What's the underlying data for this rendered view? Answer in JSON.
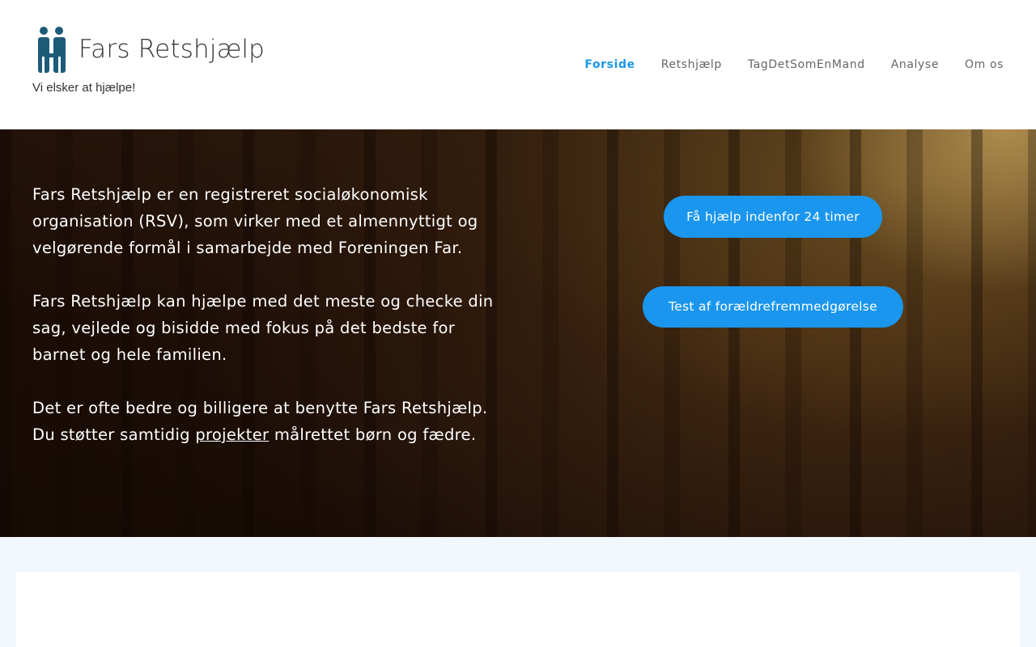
{
  "header": {
    "site_title": "Fars Retshjælp",
    "tagline": "Vi elsker at hjælpe!",
    "logo_icon": "family-logo-icon",
    "logo_color": "#1d5a78"
  },
  "nav": {
    "active_color": "#1a96e8",
    "items": [
      {
        "label": "Forside",
        "active": true
      },
      {
        "label": "Retshjælp",
        "active": false
      },
      {
        "label": "TagDetSomEnMand",
        "active": false
      },
      {
        "label": "Analyse",
        "active": false
      },
      {
        "label": "Om os",
        "active": false
      }
    ]
  },
  "hero": {
    "paragraph_1": "Fars Retshjælp er en registreret socialøkonomisk organisation (RSV), som virker med et almennyttigt og velgørende formål i samarbejde med Foreningen Far.",
    "paragraph_2": "Fars Retshjælp kan hjælpe med det meste og checke din sag, vejlede og bisidde med fokus på det bedste for barnet og hele familien.",
    "paragraph_3_line_1": "Det er ofte bedre og billigere at benytte Fars Retshjælp.",
    "paragraph_3_prefix": "Du støtter samtidig",
    "paragraph_3_link": "projekter",
    "paragraph_3_suffix": "målrettet børn og fædre.",
    "button_1": "Få hjælp indenfor 24 timer",
    "button_2": "Test af forældrefremmedgørelse",
    "button_color": "#1a96ee"
  }
}
